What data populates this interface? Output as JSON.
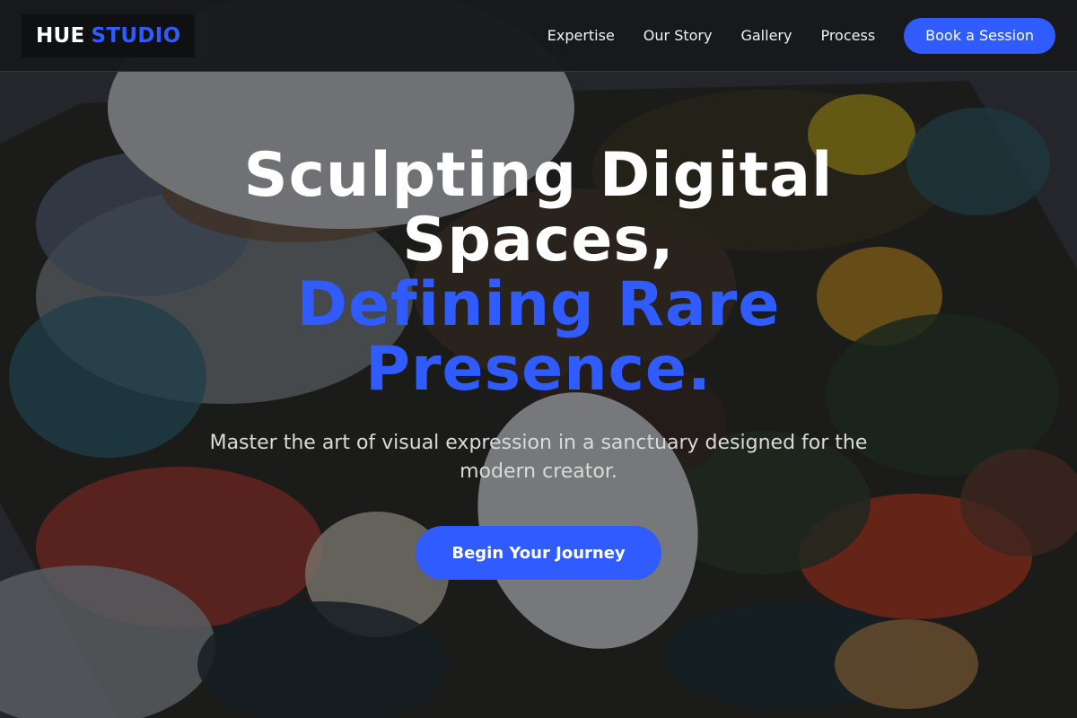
{
  "brand": {
    "part1": "HUE",
    "part2": "STUDIO"
  },
  "nav": {
    "links": [
      "Expertise",
      "Our Story",
      "Gallery",
      "Process"
    ],
    "cta_label": "Book a Session"
  },
  "hero": {
    "title_line1": "Sculpting Digital Spaces,",
    "title_line2": "Defining Rare Presence.",
    "subtitle": "Master the art of visual expression in a sanctuary designed for the modern creator.",
    "cta_label": "Begin Your Journey"
  },
  "colors": {
    "accent": "#2f5bff",
    "header_bg": "#18191c",
    "text_primary": "#ffffff",
    "text_secondary": "#dadada"
  }
}
